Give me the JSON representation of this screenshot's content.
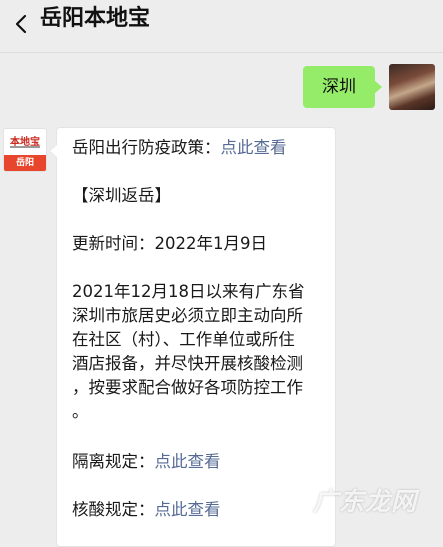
{
  "header": {
    "title": "岳阳本地宝"
  },
  "outgoing": {
    "text": "深圳"
  },
  "incoming": {
    "avatar": {
      "brand": "本地宝",
      "city": "岳阳"
    },
    "line1_prefix": "岳阳出行防疫政策：",
    "line1_link": "点此查看",
    "section_title": "【深圳返岳】",
    "update_label": "更新时间：2022年1月9日",
    "body_lines": [
      "2021年12月18日以来有广东省",
      "深圳市旅居史必须立即主动向所",
      "在社区（村）、工作单位或所住",
      "酒店报备，并尽快开展核酸检测",
      "，按要求配合做好各项防控工作",
      "。"
    ],
    "quarantine_prefix": "隔离规定：",
    "quarantine_link": "点此查看",
    "test_prefix": "核酸规定：",
    "test_link": "点此查看"
  },
  "watermark": "广东龙网",
  "colors": {
    "background": "#ededed",
    "outgoing_bubble": "#95ec69",
    "link": "#576b95",
    "logo_red": "#e8452d"
  }
}
